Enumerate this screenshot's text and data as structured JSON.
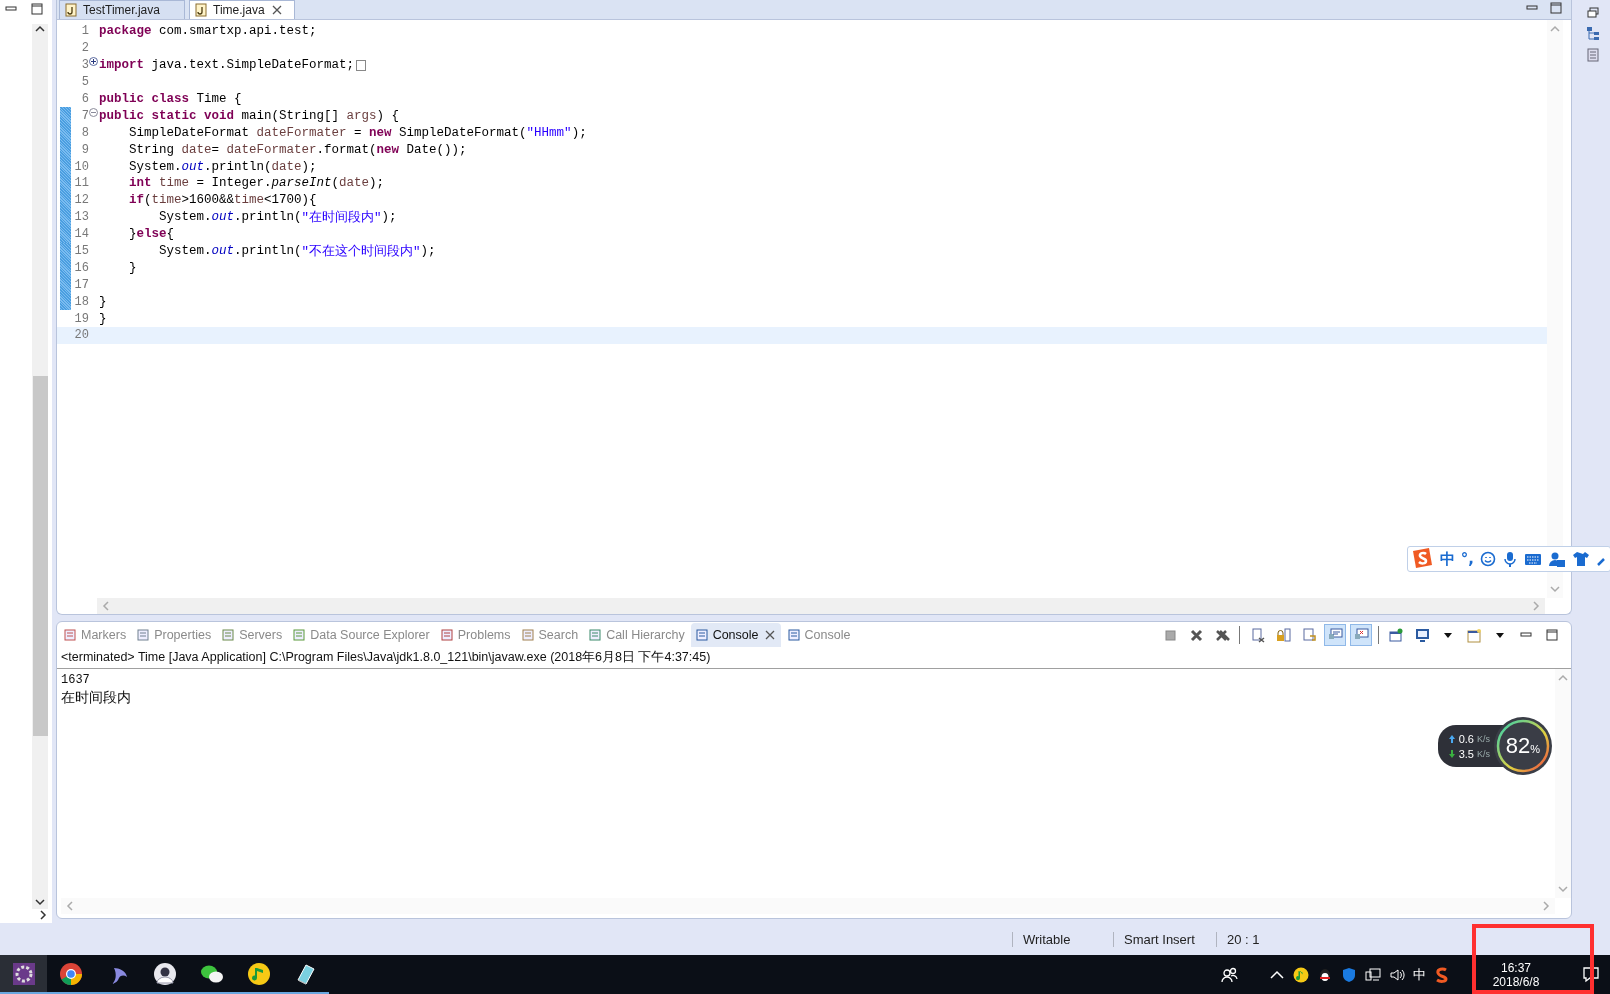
{
  "editor": {
    "tabs": [
      {
        "label": "TestTimer.java",
        "selected": false,
        "closable": false
      },
      {
        "label": "Time.java",
        "selected": true,
        "closable": true
      }
    ],
    "lines": [
      {
        "number": "1",
        "marked": false,
        "current": false,
        "tokens": [
          {
            "kind": "keyword",
            "text": "package"
          },
          {
            "kind": "text",
            "text": " com.smartxp.api.test;"
          }
        ]
      },
      {
        "number": "2",
        "marked": false,
        "current": false
      },
      {
        "number": "3",
        "marked": false,
        "current": false,
        "folding": {
          "expanded": false
        },
        "tokens": [
          {
            "kind": "keyword",
            "text": "import"
          },
          {
            "kind": "text",
            "text": " java.text.SimpleDateFormat;"
          }
        ]
      },
      {
        "number": "5",
        "marked": false,
        "current": false
      },
      {
        "number": "6",
        "marked": false,
        "current": false,
        "tokens": [
          {
            "kind": "keyword",
            "text": "public class"
          },
          {
            "kind": "text",
            "text": " Time {"
          }
        ]
      },
      {
        "number": "7",
        "marked": true,
        "current": false,
        "folding": {
          "expanded": true
        },
        "tokens": [
          {
            "kind": "keyword",
            "text": "public static void"
          },
          {
            "kind": "text",
            "text": " main(String[] "
          },
          {
            "kind": "variable",
            "text": "args"
          },
          {
            "kind": "text",
            "text": ") {"
          }
        ]
      },
      {
        "number": "8",
        "marked": true,
        "current": false,
        "tokens": [
          {
            "kind": "text",
            "text": "    SimpleDateFormat "
          },
          {
            "kind": "variable",
            "text": "dateFormater"
          },
          {
            "kind": "text",
            "text": " = "
          },
          {
            "kind": "keyword",
            "text": "new"
          },
          {
            "kind": "text",
            "text": " SimpleDateFormat("
          },
          {
            "kind": "string",
            "text": "\"HHmm\""
          },
          {
            "kind": "text",
            "text": ");"
          }
        ]
      },
      {
        "number": "9",
        "marked": true,
        "current": false,
        "tokens": [
          {
            "kind": "text",
            "text": "    String "
          },
          {
            "kind": "variable",
            "text": "date"
          },
          {
            "kind": "text",
            "text": "= "
          },
          {
            "kind": "variable",
            "text": "dateFormater"
          },
          {
            "kind": "text",
            "text": ".format("
          },
          {
            "kind": "keyword",
            "text": "new"
          },
          {
            "kind": "text",
            "text": " Date());"
          }
        ]
      },
      {
        "number": "10",
        "marked": true,
        "current": false,
        "tokens": [
          {
            "kind": "text",
            "text": "    System."
          },
          {
            "kind": "static",
            "text": "out"
          },
          {
            "kind": "text",
            "text": ".println("
          },
          {
            "kind": "variable",
            "text": "date"
          },
          {
            "kind": "text",
            "text": ");"
          }
        ]
      },
      {
        "number": "11",
        "marked": true,
        "current": false,
        "tokens": [
          {
            "kind": "keyword",
            "text": "    int"
          },
          {
            "kind": "variable",
            "text": " time"
          },
          {
            "kind": "text",
            "text": " = Integer."
          },
          {
            "kind": "method",
            "text": "parseInt"
          },
          {
            "kind": "text",
            "text": "("
          },
          {
            "kind": "variable",
            "text": "date"
          },
          {
            "kind": "text",
            "text": ");"
          }
        ]
      },
      {
        "number": "12",
        "marked": true,
        "current": false,
        "tokens": [
          {
            "kind": "keyword",
            "text": "    if"
          },
          {
            "kind": "text",
            "text": "("
          },
          {
            "kind": "variable",
            "text": "time"
          },
          {
            "kind": "text",
            "text": ">1600&&"
          },
          {
            "kind": "variable",
            "text": "time"
          },
          {
            "kind": "text",
            "text": "<1700){"
          }
        ]
      },
      {
        "number": "13",
        "marked": true,
        "current": false,
        "tokens": [
          {
            "kind": "text",
            "text": "        System."
          },
          {
            "kind": "static",
            "text": "out"
          },
          {
            "kind": "text",
            "text": ".println("
          },
          {
            "kind": "string",
            "text": "\"在时间段内\""
          },
          {
            "kind": "text",
            "text": ");"
          }
        ]
      },
      {
        "number": "14",
        "marked": true,
        "current": false,
        "tokens": [
          {
            "kind": "text",
            "text": "    }"
          },
          {
            "kind": "keyword",
            "text": "else"
          },
          {
            "kind": "text",
            "text": "{"
          }
        ]
      },
      {
        "number": "15",
        "marked": true,
        "current": false,
        "tokens": [
          {
            "kind": "text",
            "text": "        System."
          },
          {
            "kind": "static",
            "text": "out"
          },
          {
            "kind": "text",
            "text": ".println("
          },
          {
            "kind": "string",
            "text": "\"不在这个时间段内\""
          },
          {
            "kind": "text",
            "text": ");"
          }
        ]
      },
      {
        "number": "16",
        "marked": true,
        "current": false,
        "tokens": [
          {
            "kind": "text",
            "text": "    }"
          }
        ]
      },
      {
        "number": "17",
        "marked": true,
        "current": false
      },
      {
        "number": "18",
        "marked": true,
        "current": false,
        "tokens": [
          {
            "kind": "text",
            "text": "}"
          }
        ]
      },
      {
        "number": "19",
        "marked": false,
        "current": false,
        "tokens": [
          {
            "kind": "text",
            "text": "}"
          }
        ]
      },
      {
        "number": "20",
        "marked": false,
        "current": true
      }
    ]
  },
  "console": {
    "tabs": [
      {
        "label": "Markers",
        "selected": false,
        "closable": false
      },
      {
        "label": "Properties",
        "selected": false,
        "closable": false
      },
      {
        "label": "Servers",
        "selected": false,
        "closable": false
      },
      {
        "label": "Data Source Explorer",
        "selected": false,
        "closable": false
      },
      {
        "label": "Problems",
        "selected": false,
        "closable": false
      },
      {
        "label": "Search",
        "selected": false,
        "closable": false
      },
      {
        "label": "Call Hierarchy",
        "selected": false,
        "closable": false
      },
      {
        "label": "Console",
        "selected": true,
        "closable": true
      },
      {
        "label": "Console",
        "selected": false,
        "closable": false
      }
    ],
    "toolbar": [
      {
        "kind": "stop",
        "pressed": false
      },
      {
        "kind": "remove",
        "pressed": false
      },
      {
        "kind": "remove-all",
        "pressed": false
      },
      {
        "kind": "separator"
      },
      {
        "kind": "clear",
        "pressed": false
      },
      {
        "kind": "scroll-lock",
        "pressed": false
      },
      {
        "kind": "word-wrap",
        "pressed": false
      },
      {
        "kind": "stdout",
        "pressed": true
      },
      {
        "kind": "stderr",
        "pressed": true
      },
      {
        "kind": "separator"
      },
      {
        "kind": "pin",
        "pressed": false
      },
      {
        "kind": "display",
        "pressed": false
      },
      {
        "kind": "dropdown",
        "pressed": false
      },
      {
        "kind": "open",
        "pressed": false
      },
      {
        "kind": "dropdown",
        "pressed": false
      },
      {
        "kind": "minimize",
        "pressed": false
      },
      {
        "kind": "maximize",
        "pressed": false
      }
    ],
    "header": "<terminated> Time [Java Application] C:\\Program Files\\Java\\jdk1.8.0_121\\bin\\javaw.exe (2018年6月8日 下午4:37:45)",
    "output": [
      "1637",
      "在时间段内"
    ]
  },
  "ime_bar": {
    "mode": "中",
    "punctuation": "°,"
  },
  "net_widget": {
    "upload": {
      "value": "0.6",
      "unit": "K/s"
    },
    "download": {
      "value": "3.5",
      "unit": "K/s"
    },
    "usage": {
      "value": "82",
      "unit": "%"
    }
  },
  "status_bar": [
    "Writable",
    "Smart Insert",
    "20 : 1"
  ],
  "taskbar": {
    "tray_language": "中",
    "time": "16:37",
    "date": "2018/6/8"
  }
}
